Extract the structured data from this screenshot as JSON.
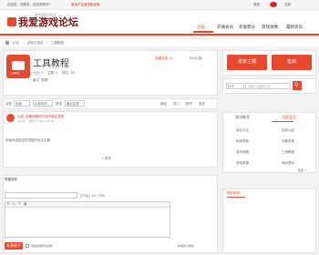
{
  "topbar": {
    "welcome": "欢迎您，请登录，还没有账号？",
    "promo": "新用户注册领取优惠",
    "contact": "发表帖子",
    "phone": "",
    "login": "登录",
    "register": "注册"
  },
  "header": {
    "logo": "我爱游戏论坛",
    "tagline": "游戏玩家交流社区"
  },
  "nav": [
    "论坛",
    "开通会员",
    "充值积分",
    "游戏攻略",
    "最新资讯"
  ],
  "breadcrumb": [
    "论坛",
    "站务公告区",
    "工具教程"
  ],
  "forum": {
    "title": "工具教程",
    "icon_caption": "工具教程",
    "stat_today": "今日: 0",
    "stat_topics": "主题: 5",
    "stat_rank": "排名: 33",
    "moderator": "版主: 暂缺",
    "fav_label": "收藏本版 (0)",
    "rss_label": "RSS订阅"
  },
  "filter": {
    "all_label": "全部",
    "time_label": "全部时间",
    "sort_label": "排序",
    "order_label": "最后发表",
    "new_label": "新帖",
    "hot_label": "热门",
    "digest_label": "精华",
    "more_label": "更多"
  },
  "threads": [
    {
      "title": "公告: 此版块暂时只允许版主发帖",
      "author": "admin",
      "date": "发表于 2021-08-19",
      "replies": "0",
      "views": "1234"
    }
  ],
  "empty_text": "本版块或指定的范围内尚无主题",
  "load_more": "+ 更多",
  "post_box": {
    "title": "快速发帖",
    "subject_placeholder": "",
    "limit_text": "还可输入 80 个字符",
    "body_placeholder": "",
    "submit": "发表帖子",
    "check_label": "发帖后跳转到最新",
    "help": "本版积分规则"
  },
  "sidebar": {
    "post_btn": "发表主题",
    "sign_btn": "签到",
    "search_placeholder": "请输入搜索内容",
    "search_select": "帖子",
    "tabs": [
      "版块推荐",
      "活跃会员"
    ],
    "forums_left": [
      "综合讨论",
      "玩家求助",
      "游戏攻略",
      "游戏资源"
    ],
    "forums_right": [
      "站务公告",
      "问题反馈",
      "工具教程",
      "休闲灌水"
    ],
    "more": "更多 >",
    "bottom_title": "精彩推荐"
  },
  "colors": {
    "accent": "#e8482e",
    "brand": "#7a1414"
  }
}
